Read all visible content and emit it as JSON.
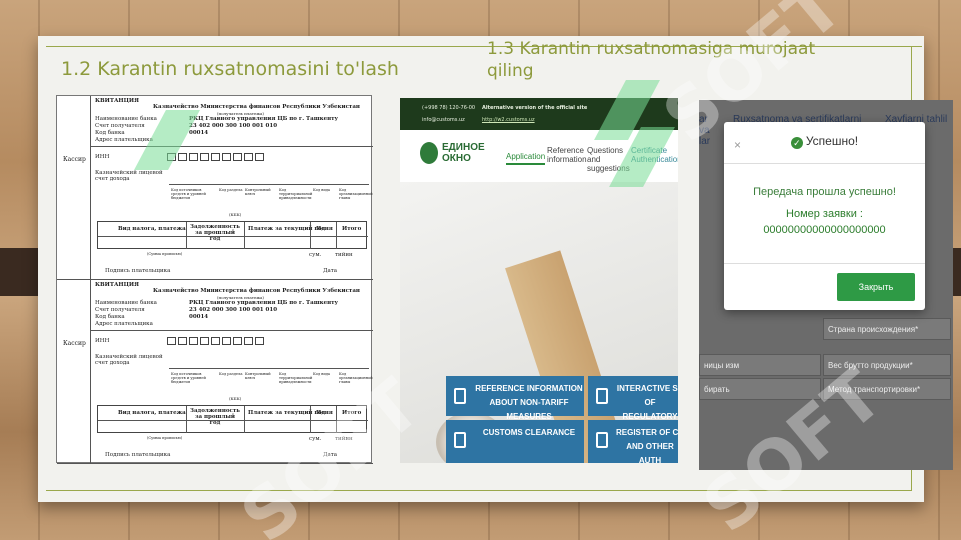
{
  "titles": {
    "left": "1.2 Karantin ruxsatnomasini to'lash",
    "right": "1.3 Karantin ruxsatnomasiga murojaat qiling"
  },
  "watermark": "SOFT",
  "receipt": {
    "heading": "КВИТАНЦИЯ",
    "org": "Казначейство Министерства финансов Республики Узбекистан",
    "org_sub": "(получатель платежа)",
    "rows": [
      {
        "label": "Наименование банка",
        "value": "РКЦ Главного управления ЦБ по г. Ташкенту"
      },
      {
        "label": "Счет получателя",
        "value": "23 402 000 300 100 001 010"
      },
      {
        "label": "Код банка",
        "value": "00014"
      },
      {
        "label": "Адрес плательщика",
        "value": ""
      }
    ],
    "cashier": "Кассир",
    "inn": "ИНН",
    "account_label": "Казначейский лицевой счет дохода",
    "cols": [
      "Код источников средств и уровней бюджетов",
      "Код раздела",
      "Контрольный ключ",
      "Код территориальной принадлежности",
      "Код вида",
      "Код организационной главы"
    ],
    "kbk": "(КБК)",
    "tbl_heads": [
      "Вид налога, платежа",
      "Задолженность за прошлый год",
      "Платеж за текущий год",
      "Пеня",
      "Итого"
    ],
    "sum_words": "(Сумма прописью)",
    "sum_units": [
      "сум.",
      "тийин"
    ],
    "sign": "Подпись плательщика",
    "date": "Дата"
  },
  "site": {
    "top_left_phone": "(+998 78) 120-76-00",
    "top_left_mail": "info@customs.uz",
    "top_right_title": "Alternative version of the official site",
    "top_right_link": "http://w2.customs.uz",
    "logo_line1": "ЕДИНОЕ",
    "logo_line2": "ОКНО",
    "nav": [
      {
        "label": "Application",
        "active": true
      },
      {
        "label": "Reference information",
        "active": false
      },
      {
        "label": "Questions and suggestions",
        "active": false
      },
      {
        "label": "Certificate Authentication",
        "active": false
      }
    ],
    "tiles": [
      {
        "label": "REFERENCE INFORMATION ABOUT NON-TARIFF MEASURES"
      },
      {
        "label": "INTERACTIVE SE OF REGULATORY AU"
      },
      {
        "label": "CUSTOMS CLEARANCE"
      },
      {
        "label": "REGISTER OF CU AND OTHER AUTH"
      }
    ]
  },
  "app": {
    "tabs": [
      "ar va lar",
      "Ruxsatnoma va sertifikatlarni",
      "Xavfiarni tahlil tizimi"
    ],
    "fields": [
      "Страна происхождения*",
      "Вес брутто продукции*",
      "Метод транспортировки*"
    ],
    "left_links": [
      "ницы изм",
      "бирать"
    ]
  },
  "modal": {
    "title": "Успешно!",
    "message": "Передача прошла успешно!",
    "req_label": "Номер заявки :",
    "req_number": "00000000000000000000",
    "close_label": "Закрыть",
    "x_label": "×"
  }
}
